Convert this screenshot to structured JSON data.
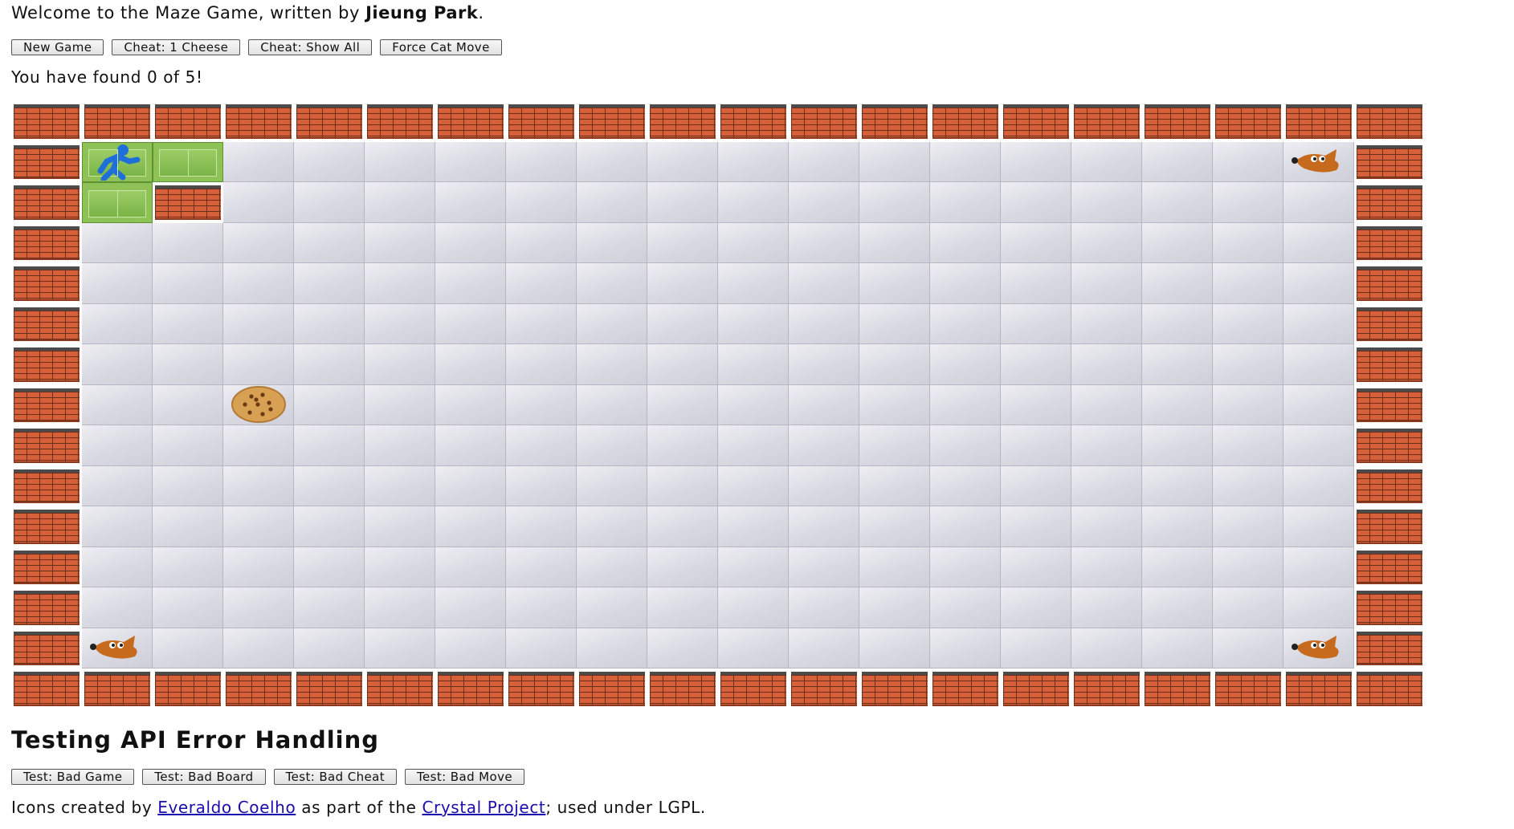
{
  "header": {
    "welcome_prefix": "Welcome to the Maze Game, written by ",
    "author": "Jieung Park",
    "welcome_suffix": "."
  },
  "controls": {
    "new_game": "New Game",
    "cheat_one_cheese": "Cheat: 1 Cheese",
    "cheat_show_all": "Cheat: Show All",
    "force_cat_move": "Force Cat Move"
  },
  "status": {
    "found_text": "You have found 0 of 5!",
    "found": 0,
    "total": 5
  },
  "board": {
    "rows": 15,
    "cols": 20,
    "tiles": [
      "WWWWWWWWWWWWWWWWWWWW",
      "WPGFFFFFFFFFFFFFFFCW",
      "WGWFFFFFFFFFFFFFFFFW",
      "WFFFFFFFFFFFFFFFFFFW",
      "WFFFFFFFFFFFFFFFFFFW",
      "WFFFFFFFFFFFFFFFFFFW",
      "WFFFFFFFFFFFFFFFFFFW",
      "WFFKFFFFFFFFFFFFFFFW",
      "WFFFFFFFFFFFFFFFFFFW",
      "WFFFFFFFFFFFFFFFFFFW",
      "WFFFFFFFFFFFFFFFFFFW",
      "WFFFFFFFFFFFFFFFFFFW",
      "WFFFFFFFFFFFFFFFFFFW",
      "WCFFFFFFFFFFFFFFFFCW",
      "WWWWWWWWWWWWWWWWWWWW"
    ],
    "legend": {
      "W": "brick-wall",
      "F": "unexplored-floor",
      "G": "grass-explored",
      "P": "player-on-grass",
      "C": "cat",
      "K": "cookie"
    },
    "colors": {
      "brick": "#d6603a",
      "floor": "#dcdce5",
      "grass": "#8ec257",
      "player": "#1e6fd9",
      "cat": "#c66a1e",
      "cookie": "#d8a052"
    }
  },
  "testing": {
    "heading": "Testing API Error Handling",
    "bad_game": "Test: Bad Game",
    "bad_board": "Test: Bad Board",
    "bad_cheat": "Test: Bad Cheat",
    "bad_move": "Test: Bad Move"
  },
  "credits": {
    "prefix": "Icons created by ",
    "author_link": "Everaldo Coelho",
    "middle": " as part of the ",
    "project_link": "Crystal Project",
    "suffix": "; used under LGPL."
  }
}
